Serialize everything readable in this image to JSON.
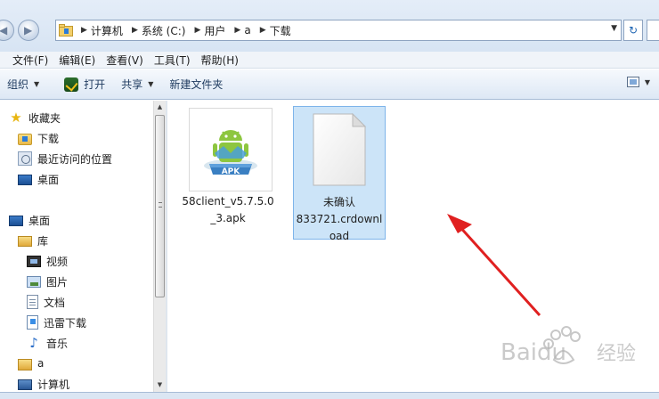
{
  "address_bar": {
    "crumbs": [
      "计算机",
      "系统 (C:)",
      "用户",
      "a",
      "下载"
    ]
  },
  "menu": {
    "items": [
      "文件(F)",
      "编辑(E)",
      "查看(V)",
      "工具(T)",
      "帮助(H)"
    ]
  },
  "toolbar": {
    "organize": "组织",
    "open": "打开",
    "share": "共享",
    "new_folder": "新建文件夹"
  },
  "nav": {
    "favorites": "收藏夹",
    "downloads": "下载",
    "recent": "最近访问的位置",
    "desktop_fav": "桌面",
    "desktop": "桌面",
    "libraries": "库",
    "videos": "视频",
    "pictures": "图片",
    "documents": "文档",
    "thunder": "迅雷下载",
    "music": "音乐",
    "user": "a",
    "computer": "计算机"
  },
  "files": [
    {
      "label_lines": [
        "58client_v5.7.5.0",
        "_3.apk"
      ],
      "icon": "apk-android-icon",
      "selected": false
    },
    {
      "label_lines": [
        "未确认",
        "833721.crdownl",
        "oad"
      ],
      "icon": "blank-document-icon",
      "selected": true
    }
  ],
  "apk_badge": "APK",
  "watermark": {
    "text": "Baidu",
    "suffix": "经验"
  },
  "colors": {
    "selection": "#cce4f8",
    "arrow": "#e02020"
  }
}
